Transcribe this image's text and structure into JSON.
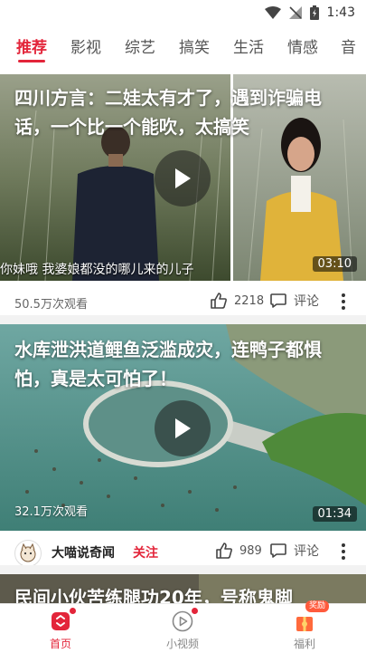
{
  "status_bar": {
    "time": "1:43"
  },
  "tabs": [
    {
      "label": "推荐",
      "active": true
    },
    {
      "label": "影视",
      "active": false
    },
    {
      "label": "综艺",
      "active": false
    },
    {
      "label": "搞笑",
      "active": false
    },
    {
      "label": "生活",
      "active": false
    },
    {
      "label": "情感",
      "active": false
    },
    {
      "label": "音",
      "active": false
    }
  ],
  "videos": [
    {
      "title": "四川方言：二娃太有才了，遇到诈骗电话，一个比一个能吹，太搞笑",
      "subtitle": "你妹哦 我婆娘都没的哪儿来的儿子",
      "duration": "03:10",
      "views": "50.5万次观看",
      "likes": "2218",
      "comment_label": "评论"
    },
    {
      "title": "水库泄洪道鲤鱼泛滥成灾，连鸭子都惧怕，真是太可怕了！",
      "duration": "01:34",
      "views": "32.1万次观看",
      "author": "大喵说奇闻",
      "follow_label": "关注",
      "likes": "989",
      "comment_label": "评论"
    },
    {
      "title": "民间小伙苦练腿功20年，号称鬼脚"
    }
  ],
  "bottom_nav": {
    "home": "首页",
    "short_video": "小视频",
    "welfare": "福利",
    "reward_badge": "奖励"
  },
  "colors": {
    "accent": "#e3253a",
    "divider": "#f2f2f2"
  }
}
